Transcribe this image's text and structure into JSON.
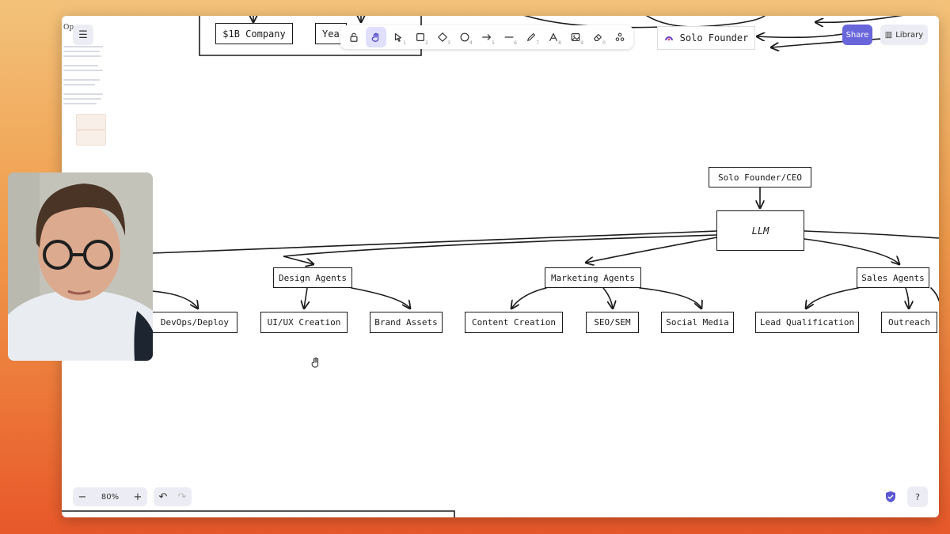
{
  "toolbar": {
    "menu_icon": "hamburger-menu-icon",
    "tools": [
      {
        "name": "lock",
        "key": ""
      },
      {
        "name": "hand",
        "key": ""
      },
      {
        "name": "select",
        "key": "1"
      },
      {
        "name": "rectangle",
        "key": "2"
      },
      {
        "name": "diamond",
        "key": "3"
      },
      {
        "name": "ellipse",
        "key": "4"
      },
      {
        "name": "arrow",
        "key": "5"
      },
      {
        "name": "line",
        "key": "6"
      },
      {
        "name": "draw",
        "key": "7"
      },
      {
        "name": "text",
        "key": "8"
      },
      {
        "name": "image",
        "key": "9"
      },
      {
        "name": "eraser",
        "key": "0"
      },
      {
        "name": "more",
        "key": ""
      }
    ],
    "share_label": "Share",
    "library_label": "Library"
  },
  "diagram": {
    "top_nodes": {
      "company": "$1B Company",
      "year": "Yea",
      "solo_founder_top": "Solo Founder"
    },
    "root": "Solo Founder/CEO",
    "llm": "LLM",
    "categories": {
      "design": "Design Agents",
      "marketing": "Marketing Agents",
      "sales": "Sales Agents"
    },
    "leaves": {
      "devops": "DevOps/Deploy",
      "uiux": "UI/UX Creation",
      "brand": "Brand Assets",
      "content": "Content Creation",
      "seo": "SEO/SEM",
      "social": "Social Media",
      "lead": "Lead Qualification",
      "outreach": "Outreach"
    }
  },
  "footer": {
    "zoom": "80%",
    "zoom_out": "−",
    "zoom_in": "+",
    "undo": "↶",
    "redo": "↷",
    "help": "?"
  },
  "sidebar_letter": "Op"
}
